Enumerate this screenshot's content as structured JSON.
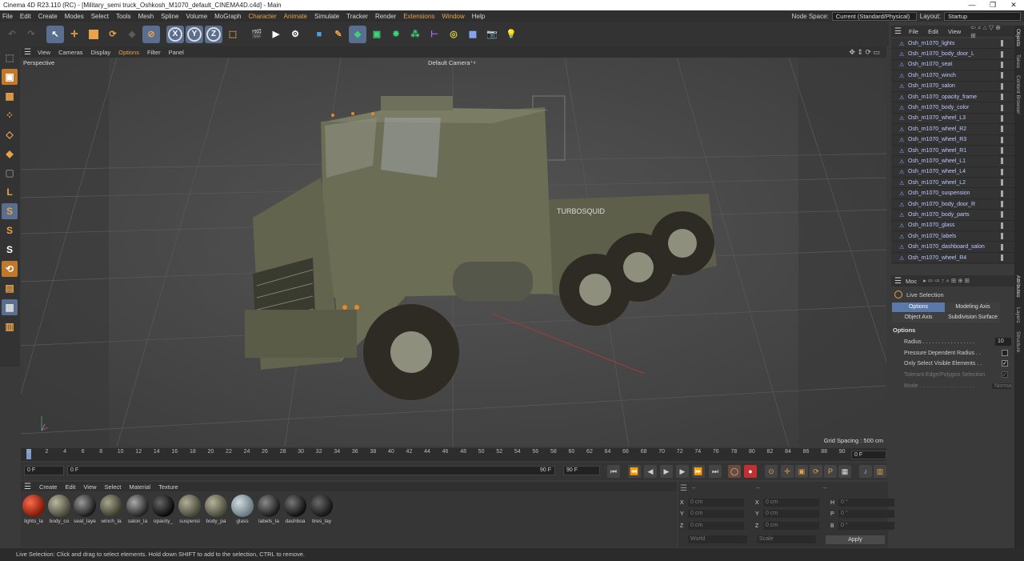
{
  "window": {
    "title": "Cinema 4D R23.110 (RC) - [Military_semi truck_Oshkosh_M1070_default_CINEMA4D.c4d] - Main",
    "minimize": "—",
    "maximize": "❐",
    "close": "✕"
  },
  "menubar": {
    "items": [
      "File",
      "Edit",
      "Create",
      "Modes",
      "Select",
      "Tools",
      "Mesh",
      "Spline",
      "Volume",
      "MoGraph",
      "Character",
      "Animate",
      "Simulate",
      "Tracker",
      "Render",
      "Extensions",
      "Window",
      "Help"
    ],
    "node_space_label": "Node Space:",
    "node_space_value": "Current (Standard/Physical)",
    "layout_label": "Layout:",
    "layout_value": "Startup"
  },
  "toolbar": {
    "axis_x": "X",
    "axis_y": "Y",
    "axis_z": "Z"
  },
  "viewport": {
    "menu": [
      "View",
      "Cameras",
      "Display",
      "Options",
      "Filter",
      "Panel"
    ],
    "active_menu": "Options",
    "label": "Perspective",
    "camera": "Default Camera",
    "camera_suffix": "⁺⁹",
    "grid_spacing": "Grid Spacing : 500 cm",
    "watermark_text": "TURBOSQUID"
  },
  "timeline": {
    "ticks": [
      "0",
      "2",
      "4",
      "6",
      "8",
      "10",
      "12",
      "14",
      "16",
      "18",
      "20",
      "22",
      "24",
      "26",
      "28",
      "30",
      "32",
      "34",
      "36",
      "38",
      "40",
      "42",
      "44",
      "46",
      "48",
      "50",
      "52",
      "54",
      "56",
      "58",
      "60",
      "62",
      "64",
      "66",
      "68",
      "70",
      "72",
      "74",
      "76",
      "78",
      "80",
      "82",
      "84",
      "86",
      "88",
      "90"
    ],
    "current_frame_right": "0 F",
    "start_frame": "0 F",
    "range_start": "0 F",
    "range_end": "90 F",
    "end_frame": "90 F"
  },
  "materials": {
    "menu": [
      "Create",
      "Edit",
      "View",
      "Select",
      "Material",
      "Texture"
    ],
    "items": [
      "lights_la",
      "body_co",
      "seat_laye",
      "winch_la",
      "salon_la",
      "opacity_",
      "suspensi",
      "body_pa",
      "glass",
      "labels_la",
      "dashboa",
      "tires_lay"
    ]
  },
  "coordinates": {
    "header_dashes": [
      "--",
      "--",
      "--"
    ],
    "rows": [
      {
        "axis1": "X",
        "val1": "0 cm",
        "axis2": "X",
        "val2": "0 cm",
        "axis3": "H",
        "val3": "0 °"
      },
      {
        "axis1": "Y",
        "val1": "0 cm",
        "axis2": "Y",
        "val2": "0 cm",
        "axis3": "P",
        "val3": "0 °"
      },
      {
        "axis1": "Z",
        "val1": "0 cm",
        "axis2": "Z",
        "val2": "0 cm",
        "axis3": "B",
        "val3": "0 °"
      }
    ],
    "mode1": "World",
    "mode2": "Scale",
    "apply": "Apply"
  },
  "object_manager": {
    "menu": [
      "File",
      "Edit",
      "View"
    ],
    "objects": [
      "Osh_m1070_lights",
      "Osh_m1070_body_door_L",
      "Osh_m1070_seat",
      "Osh_m1070_winch",
      "Osh_m1070_salon",
      "Osh_m1070_opacity_frame",
      "Osh_m1070_body_color",
      "Osh_m1070_wheel_L3",
      "Osh_m1070_wheel_R2",
      "Osh_m1070_wheel_R3",
      "Osh_m1070_wheel_R1",
      "Osh_m1070_wheel_L1",
      "Osh_m1070_wheel_L4",
      "Osh_m1070_wheel_L2",
      "Osh_m1070_suspension",
      "Osh_m1070_body_door_R",
      "Osh_m1070_body_parts",
      "Osh_m1070_glass",
      "Osh_m1070_labels",
      "Osh_m1070_dashboard_salon",
      "Osh_m1070_wheel_R4"
    ]
  },
  "attributes": {
    "mode": "Moc",
    "tool_name": "Live Selection",
    "tabs": [
      "Options",
      "Modeling Axis",
      "Object Axis",
      "Subdivision Surface"
    ],
    "active_tab": "Options",
    "section": "Options",
    "radius_label": "Radius . . . . . . . . . . . . . . . . .",
    "radius_value": "10",
    "pressure_label": "Pressure Dependent Radius . .",
    "visible_label": "Only Select Visible Elements . .",
    "tolerant_label": "Tolerant Edge/Polygon Selection",
    "mode_label": "Mode . . . . . . . . . . . . . . . . . .",
    "mode_value": "Normal"
  },
  "side_tabs": [
    "Objects",
    "Takes",
    "Content Browser",
    "Attributes",
    "Layers",
    "Structure"
  ],
  "statusbar": {
    "text": "Live Selection: Click and drag to select elements. Hold down SHIFT to add to the selection, CTRL to remove."
  },
  "colors": {
    "accent": "#e8a24a",
    "highlight": "#5a78a8",
    "truck": "#6b6d55"
  }
}
